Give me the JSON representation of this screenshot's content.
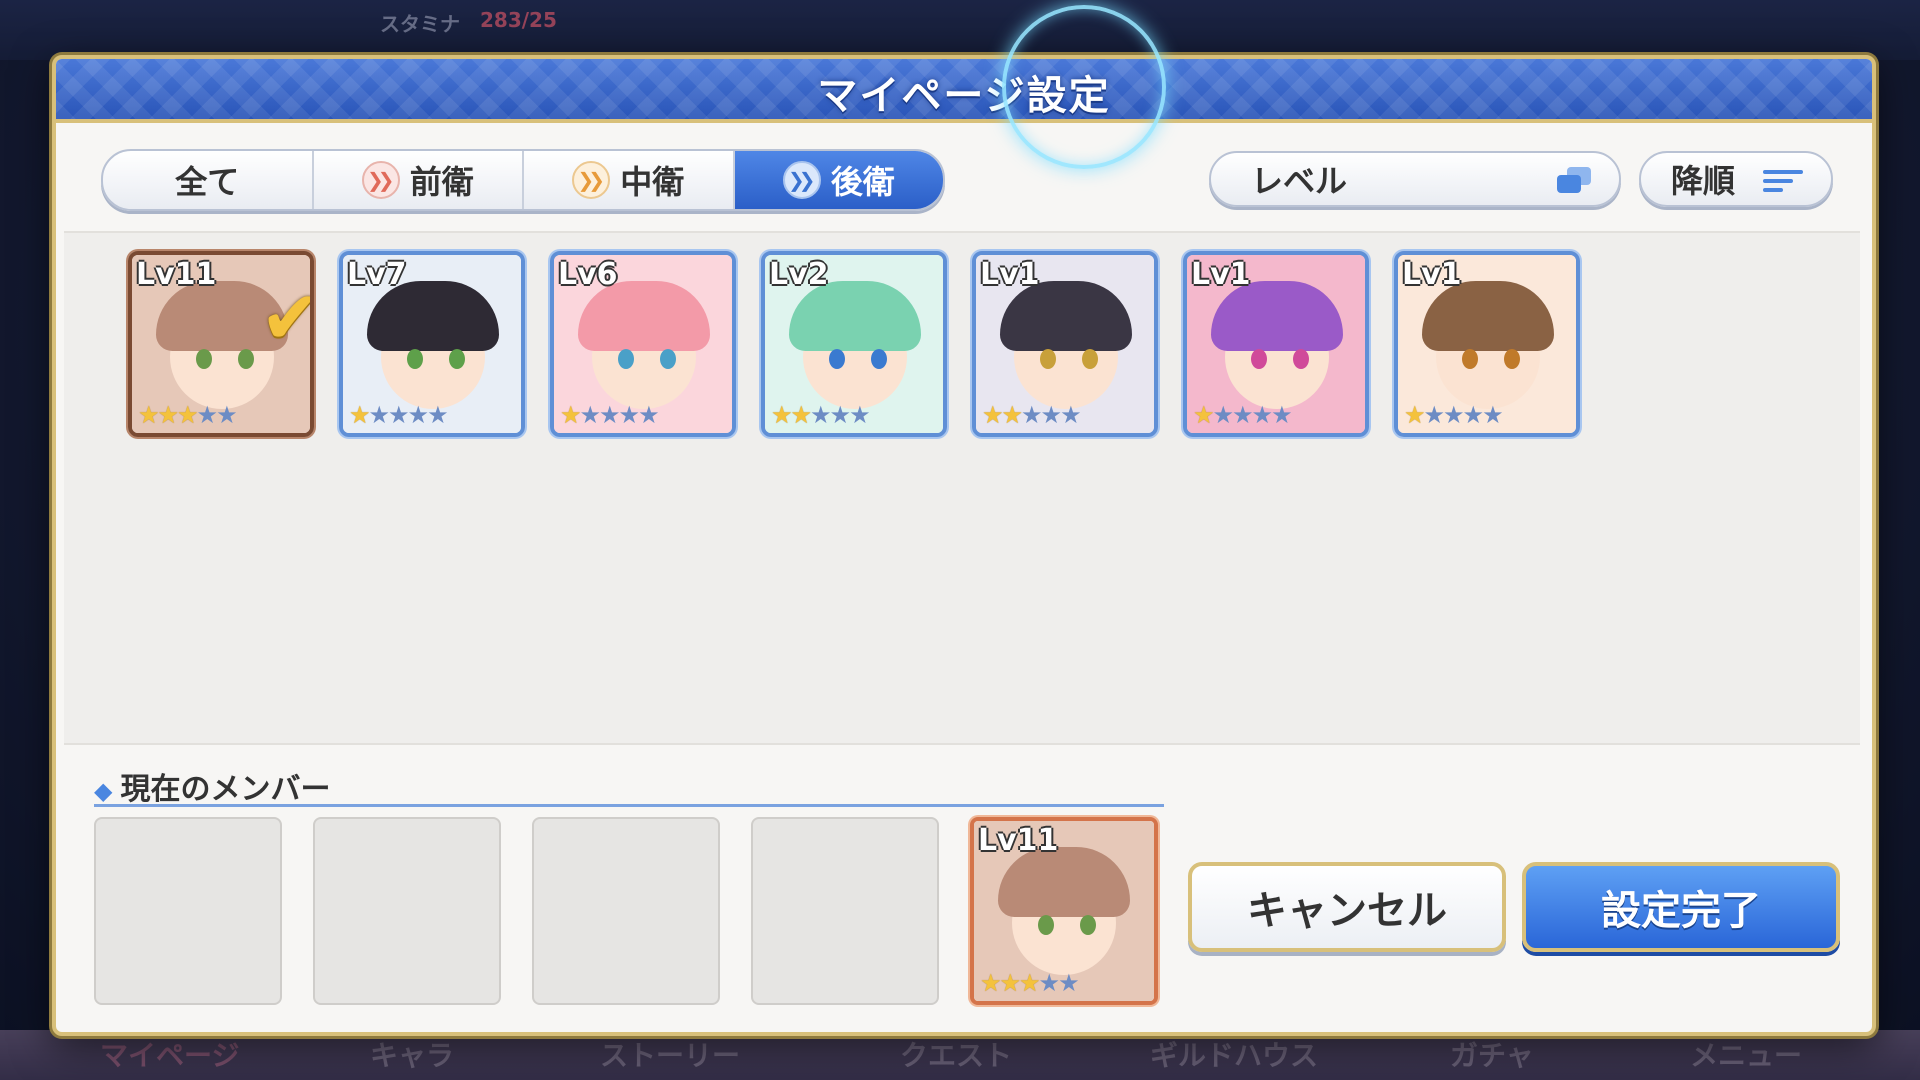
{
  "background": {
    "stamina_label": "スタミナ",
    "stamina_value": "283/25",
    "nav": [
      "マイページ",
      "キャラ",
      "ストーリー",
      "クエスト",
      "ギルドハウス",
      "ガチャ",
      "メニュー"
    ]
  },
  "dialog": {
    "title": "マイページ設定",
    "tabs": [
      {
        "label": "全て",
        "icon": "",
        "active": false
      },
      {
        "label": "前衛",
        "icon": "front-position-icon",
        "active": false
      },
      {
        "label": "中衛",
        "icon": "middle-position-icon",
        "active": false
      },
      {
        "label": "後衛",
        "icon": "rear-position-icon",
        "active": true
      }
    ],
    "sort": {
      "key_label": "レベル",
      "order_label": "降順"
    },
    "characters": [
      {
        "level": "Lv11",
        "stars": 3,
        "selected": true,
        "hair": "#b98a76",
        "eyes": "#6a9a4a",
        "bg": "#e6c8b8"
      },
      {
        "level": "Lv7",
        "stars": 1,
        "selected": false,
        "hair": "#2e2a34",
        "eyes": "#5ea04a",
        "bg": "#e8eef6"
      },
      {
        "level": "Lv6",
        "stars": 1,
        "selected": false,
        "hair": "#f39aa8",
        "eyes": "#4aa0c8",
        "bg": "#fbd6dc"
      },
      {
        "level": "Lv2",
        "stars": 2,
        "selected": false,
        "hair": "#7ad2b0",
        "eyes": "#3a7ad0",
        "bg": "#dff4ee"
      },
      {
        "level": "Lv1",
        "stars": 2,
        "selected": false,
        "hair": "#3a3644",
        "eyes": "#c8a03a",
        "bg": "#e8e6f0"
      },
      {
        "level": "Lv1",
        "stars": 1,
        "selected": false,
        "hair": "#9a5ac8",
        "eyes": "#d04a9a",
        "bg": "#f4b8cc"
      },
      {
        "level": "Lv1",
        "stars": 1,
        "selected": false,
        "hair": "#8a6244",
        "eyes": "#c07a2a",
        "bg": "#fbe8da"
      }
    ],
    "members_title": "現在のメンバー",
    "member_slots": [
      {
        "filled": false
      },
      {
        "filled": false
      },
      {
        "filled": false
      },
      {
        "filled": false
      },
      {
        "filled": true,
        "level": "Lv11",
        "stars": 3
      }
    ],
    "cancel_label": "キャンセル",
    "confirm_label": "設定完了"
  }
}
